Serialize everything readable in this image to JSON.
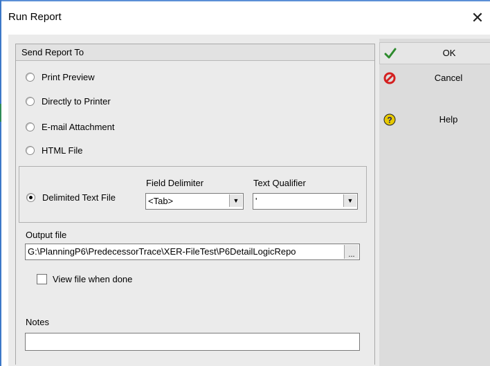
{
  "window": {
    "title": "Run Report",
    "close_glyph": "✕"
  },
  "send_report_to": {
    "header": "Send Report To",
    "options": [
      {
        "label": "Print Preview",
        "selected": false
      },
      {
        "label": "Directly to Printer",
        "selected": false
      },
      {
        "label": "E-mail Attachment",
        "selected": false
      },
      {
        "label": "HTML File",
        "selected": false
      },
      {
        "label": "Delimited Text File",
        "selected": true
      }
    ]
  },
  "delimited": {
    "field_delimiter_label": "Field Delimiter",
    "field_delimiter_value": "<Tab>",
    "text_qualifier_label": "Text Qualifier",
    "text_qualifier_value": "'"
  },
  "output": {
    "label": "Output file",
    "path": "G:\\PlanningP6\\PredecessorTrace\\XER-FileTest\\P6DetailLogicRepo",
    "browse_label": "...",
    "view_when_done_label": "View file when done",
    "view_when_done_checked": false
  },
  "notes": {
    "label": "Notes",
    "value": ""
  },
  "buttons": {
    "ok": {
      "label": "OK",
      "icon": "check-icon",
      "color": "#2e8b2e"
    },
    "cancel": {
      "label": "Cancel",
      "icon": "cancel-icon",
      "color": "#d42020"
    },
    "help": {
      "label": "Help",
      "icon": "help-icon",
      "color": "#e6c800"
    }
  }
}
